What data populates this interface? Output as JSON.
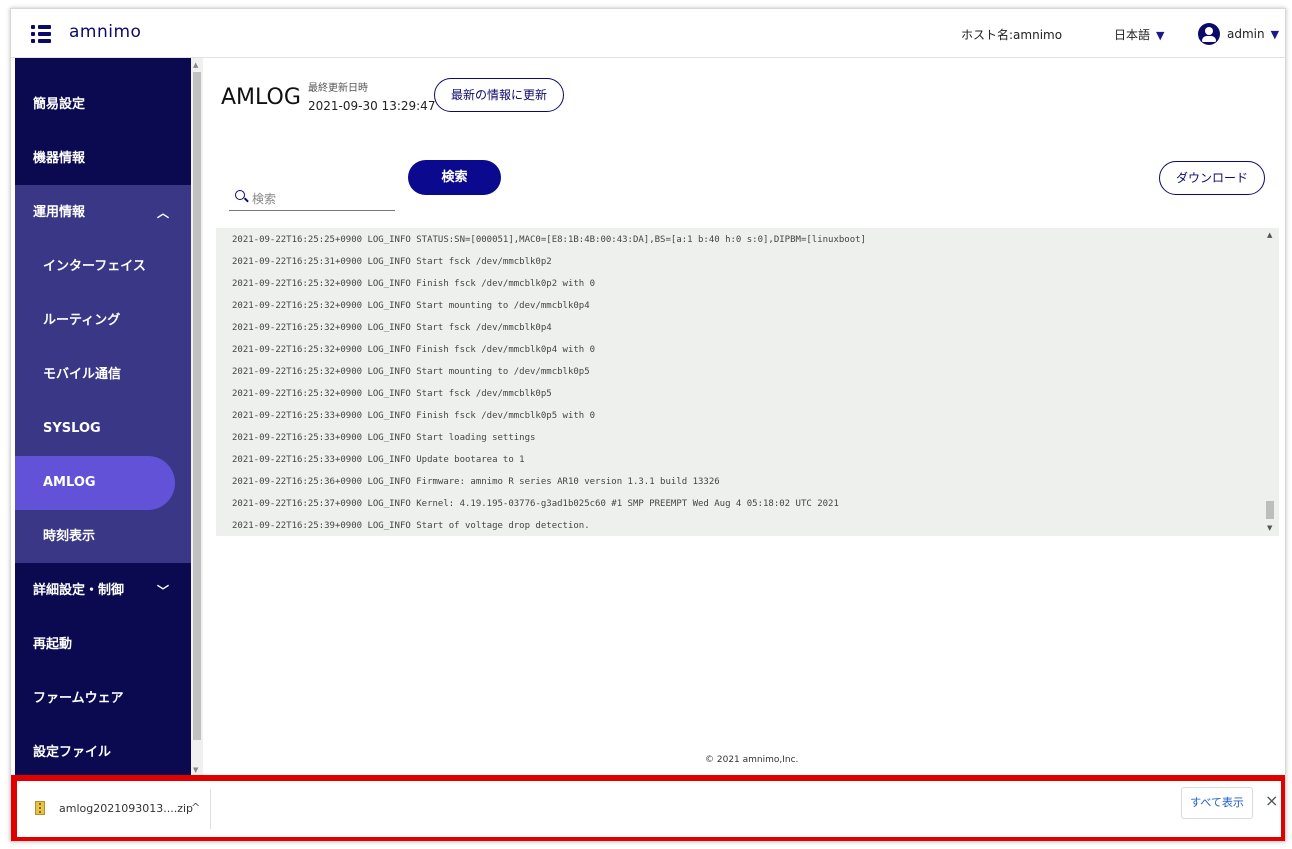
{
  "header": {
    "logo_text": "amnimo",
    "host_label": "ホスト名:amnimo",
    "language": "日本語",
    "user": "admin",
    "caret": "▼"
  },
  "sidebar": {
    "items": [
      {
        "label": "簡易設定"
      },
      {
        "label": "機器情報"
      },
      {
        "label": "運用情報",
        "expanded": true
      },
      {
        "label": "インターフェイス"
      },
      {
        "label": "ルーティング"
      },
      {
        "label": "モバイル通信"
      },
      {
        "label": "SYSLOG"
      },
      {
        "label": "AMLOG",
        "active": true
      },
      {
        "label": "時刻表示"
      },
      {
        "label": "詳細設定・制御"
      },
      {
        "label": "再起動"
      },
      {
        "label": "ファームウェア"
      },
      {
        "label": "設定ファイル"
      }
    ]
  },
  "main": {
    "title": "AMLOG",
    "last_updated_label": "最終更新日時",
    "last_updated_value": "2021-09-30 13:29:47",
    "refresh_button": "最新の情報に更新",
    "search_placeholder": "検索",
    "search_button": "検索",
    "download_button": "ダウンロード",
    "log_lines": [
      "2021-09-22T16:25:25+0900 LOG_INFO STATUS:SN=[000051],MAC0=[E8:1B:4B:00:43:DA],BS=[a:1 b:40 h:0 s:0],DIPBM=[linuxboot]",
      "2021-09-22T16:25:31+0900 LOG_INFO Start fsck /dev/mmcblk0p2",
      "2021-09-22T16:25:32+0900 LOG_INFO Finish fsck /dev/mmcblk0p2 with 0",
      "2021-09-22T16:25:32+0900 LOG_INFO Start mounting to /dev/mmcblk0p4",
      "2021-09-22T16:25:32+0900 LOG_INFO Start fsck /dev/mmcblk0p4",
      "2021-09-22T16:25:32+0900 LOG_INFO Finish fsck /dev/mmcblk0p4 with 0",
      "2021-09-22T16:25:32+0900 LOG_INFO Start mounting to /dev/mmcblk0p5",
      "2021-09-22T16:25:32+0900 LOG_INFO Start fsck /dev/mmcblk0p5",
      "2021-09-22T16:25:33+0900 LOG_INFO Finish fsck /dev/mmcblk0p5 with 0",
      "2021-09-22T16:25:33+0900 LOG_INFO Start loading settings",
      "2021-09-22T16:25:33+0900 LOG_INFO Update bootarea to 1",
      "2021-09-22T16:25:36+0900 LOG_INFO Firmware: amnimo R series AR10 version 1.3.1 build 13326",
      "2021-09-22T16:25:37+0900 LOG_INFO Kernel: 4.19.195-03776-g3ad1b025c60 #1 SMP PREEMPT Wed Aug 4 05:18:02 UTC 2021",
      "2021-09-22T16:25:39+0900 LOG_INFO Start of voltage drop detection."
    ],
    "copyright": "© 2021 amnimo,Inc."
  },
  "download_shelf": {
    "file_name": "amlog2021093013....zip",
    "show_all": "すべて表示",
    "close": "×",
    "caret": "^"
  },
  "colors": {
    "sidebar_bg": "#0b0a50",
    "sidebar_sub_bg": "#3a3786",
    "active_item": "#6152d8",
    "primary": "#0b0a8e",
    "highlight_border": "#e00000"
  }
}
